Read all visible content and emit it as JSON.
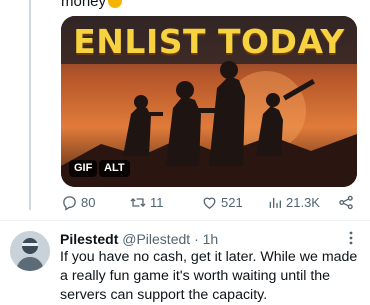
{
  "previous_tweet": {
    "text_tail": "money"
  },
  "media": {
    "headline": "ENLIST TODAY",
    "gif_badge": "GIF",
    "alt_badge": "ALT"
  },
  "actions": {
    "replies": "80",
    "reposts": "11",
    "likes": "521",
    "views": "21.3K"
  },
  "reply": {
    "display_name": "Pilestedt",
    "handle": "@Pilestedt",
    "separator": "·",
    "time": "1h",
    "text": "If you have no cash, get it later. While we made a really fun game it's worth waiting until the servers can support the capacity."
  },
  "colors": {
    "text": "#0f1419",
    "muted": "#536471",
    "headline": "#f6d33f"
  }
}
